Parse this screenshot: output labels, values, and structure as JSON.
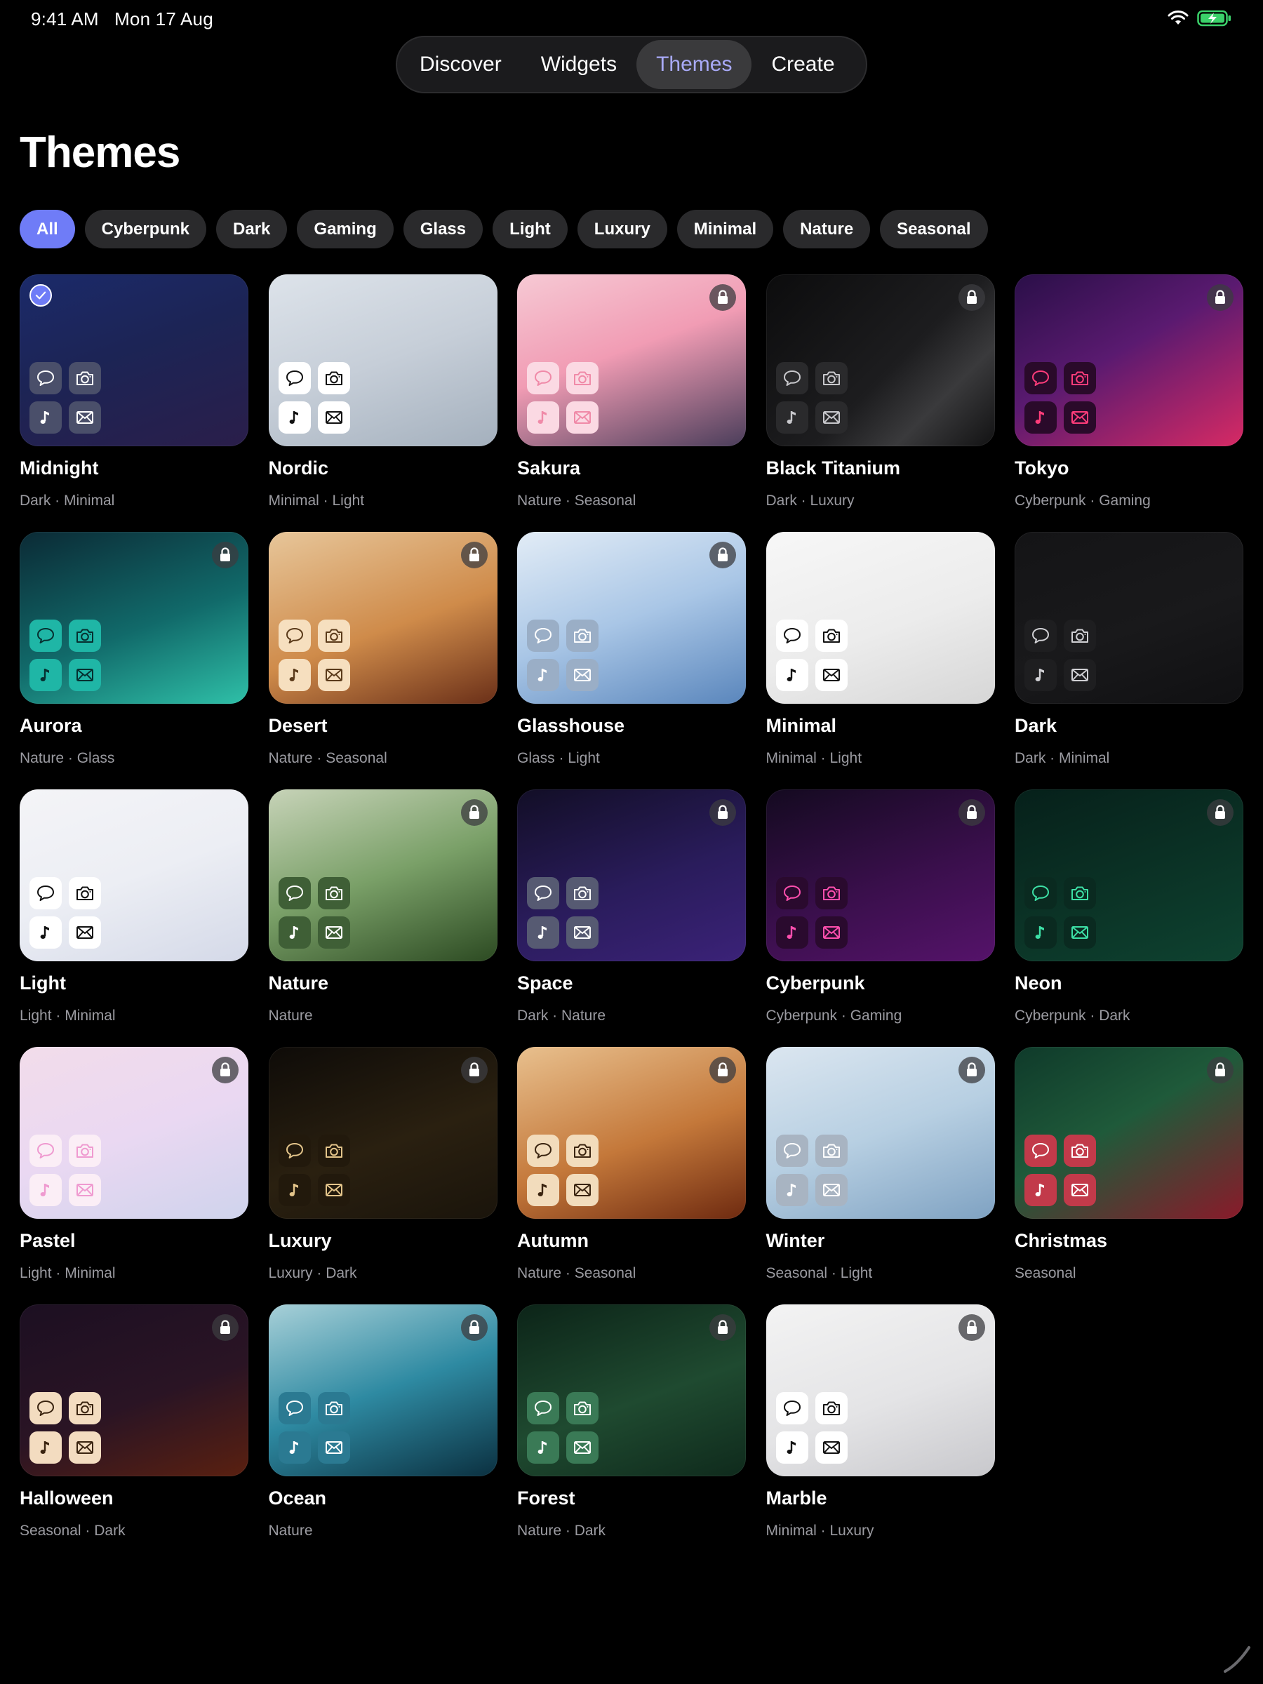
{
  "status": {
    "time": "9:41 AM",
    "date": "Mon 17 Aug"
  },
  "nav": {
    "tabs": [
      {
        "label": "Discover",
        "active": false
      },
      {
        "label": "Widgets",
        "active": false
      },
      {
        "label": "Themes",
        "active": true
      },
      {
        "label": "Create",
        "active": false
      }
    ]
  },
  "page": {
    "title": "Themes"
  },
  "filters": {
    "chips": [
      {
        "label": "All",
        "active": true
      },
      {
        "label": "Cyberpunk",
        "active": false
      },
      {
        "label": "Dark",
        "active": false
      },
      {
        "label": "Gaming",
        "active": false
      },
      {
        "label": "Glass",
        "active": false
      },
      {
        "label": "Light",
        "active": false
      },
      {
        "label": "Luxury",
        "active": false
      },
      {
        "label": "Minimal",
        "active": false
      },
      {
        "label": "Nature",
        "active": false
      },
      {
        "label": "Seasonal",
        "active": false
      }
    ]
  },
  "themes": [
    {
      "name": "Midnight",
      "tags": "Dark · Minimal",
      "selected": true,
      "locked": false,
      "bg": "linear-gradient(160deg,#1b2a6a 0%,#1c2455 45%,#2a1e4a 100%)",
      "icon_bg": "#4a4f6a",
      "icon_fg": "#ffffff"
    },
    {
      "name": "Nordic",
      "tags": "Minimal · Light",
      "selected": false,
      "locked": false,
      "bg": "linear-gradient(160deg,#dde3ea 0%,#c6ced8 50%,#a4b0bd 100%)",
      "icon_bg": "#ffffff",
      "icon_fg": "#111111"
    },
    {
      "name": "Sakura",
      "tags": "Nature · Seasonal",
      "selected": false,
      "locked": true,
      "bg": "linear-gradient(160deg,#f6c9d4 0%,#f19cb4 45%,#4a3d5a 100%)",
      "icon_bg": "#fbd9e3",
      "icon_fg": "#f08aa8"
    },
    {
      "name": "Black Titanium",
      "tags": "Dark · Luxury",
      "selected": false,
      "locked": true,
      "bg": "linear-gradient(135deg,#0c0c0d 0%,#1d1d1f 55%,#3a3a3c 75%,#121213 100%)",
      "icon_bg": "#2a2a2c",
      "icon_fg": "#c8c8cc"
    },
    {
      "name": "Tokyo",
      "tags": "Cyberpunk · Gaming",
      "selected": false,
      "locked": true,
      "bg": "linear-gradient(150deg,#2a0f48 0%,#5a1a70 45%,#d72a64 100%)",
      "icon_bg": "#2a0a2a",
      "icon_fg": "#ff3c7a"
    },
    {
      "name": "Aurora",
      "tags": "Nature · Glass",
      "selected": false,
      "locked": true,
      "bg": "linear-gradient(160deg,#0b2a35 0%,#116a6a 55%,#2fc0a8 100%)",
      "icon_bg": "#1fb6a6",
      "icon_fg": "#063030"
    },
    {
      "name": "Desert",
      "tags": "Nature · Seasonal",
      "selected": false,
      "locked": true,
      "bg": "linear-gradient(160deg,#e7c69a 0%,#cf8b4a 55%,#6a2f18 100%)",
      "icon_bg": "#f6dfbf",
      "icon_fg": "#5a3a1a"
    },
    {
      "name": "Glasshouse",
      "tags": "Glass · Light",
      "selected": false,
      "locked": true,
      "bg": "linear-gradient(160deg,#e2ecf6 0%,#a9c6e6 50%,#5a86bc 100%)",
      "icon_bg": "#9aaec6",
      "icon_fg": "#ffffff"
    },
    {
      "name": "Minimal",
      "tags": "Minimal · Light",
      "selected": false,
      "locked": false,
      "bg": "linear-gradient(160deg,#f7f7f7 0%,#ececec 55%,#d6d6d6 100%)",
      "icon_bg": "#ffffff",
      "icon_fg": "#111111"
    },
    {
      "name": "Dark",
      "tags": "Dark · Minimal",
      "selected": false,
      "locked": false,
      "bg": "linear-gradient(160deg,#141416 0%,#19191b 55%,#101012 100%)",
      "icon_bg": "#1e1e20",
      "icon_fg": "#d0d0d4"
    },
    {
      "name": "Light",
      "tags": "Light · Minimal",
      "selected": false,
      "locked": false,
      "bg": "linear-gradient(160deg,#f4f4f7 0%,#eceef4 50%,#d4d9e8 100%)",
      "icon_bg": "#ffffff",
      "icon_fg": "#111111"
    },
    {
      "name": "Nature",
      "tags": "Nature",
      "selected": false,
      "locked": true,
      "bg": "linear-gradient(160deg,#c7d3b8 0%,#7aa068 50%,#2c4a22 100%)",
      "icon_bg": "#3f5f36",
      "icon_fg": "#ffffff"
    },
    {
      "name": "Space",
      "tags": "Dark · Nature",
      "selected": false,
      "locked": true,
      "bg": "linear-gradient(160deg,#120e26 0%,#2a1c5c 55%,#3b2278 100%)",
      "icon_bg": "#565a72",
      "icon_fg": "#ffffff"
    },
    {
      "name": "Cyberpunk",
      "tags": "Cyberpunk · Gaming",
      "selected": false,
      "locked": true,
      "bg": "linear-gradient(160deg,#140a20 0%,#3a0f4c 55%,#55136a 100%)",
      "icon_bg": "#2a0a2e",
      "icon_fg": "#ff4fae"
    },
    {
      "name": "Neon",
      "tags": "Cyberpunk · Dark",
      "selected": false,
      "locked": true,
      "bg": "linear-gradient(160deg,#06201a 0%,#0b3326 55%,#0e4230 100%)",
      "icon_bg": "#0a2a20",
      "icon_fg": "#3de0a6"
    },
    {
      "name": "Pastel",
      "tags": "Light · Minimal",
      "selected": false,
      "locked": true,
      "bg": "linear-gradient(160deg,#f2dcea 0%,#ead8f2 50%,#cfd3ec 100%)",
      "icon_bg": "#fbeef6",
      "icon_fg": "#ef9ad0"
    },
    {
      "name": "Luxury",
      "tags": "Luxury · Dark",
      "selected": false,
      "locked": true,
      "bg": "linear-gradient(160deg,#0e0b08 0%,#2a2010 55%,#1a140b 100%)",
      "icon_bg": "#22190c",
      "icon_fg": "#e3c48a"
    },
    {
      "name": "Autumn",
      "tags": "Nature · Seasonal",
      "selected": false,
      "locked": true,
      "bg": "linear-gradient(160deg,#e8c08e 0%,#c4783a 55%,#6e2a10 100%)",
      "icon_bg": "#f2dcbc",
      "icon_fg": "#3a2410"
    },
    {
      "name": "Winter",
      "tags": "Seasonal · Light",
      "selected": false,
      "locked": true,
      "bg": "linear-gradient(160deg,#dbe6f0 0%,#b7cfe2 50%,#7fa2c2 100%)",
      "icon_bg": "#a8b4c2",
      "icon_fg": "#ffffff"
    },
    {
      "name": "Christmas",
      "tags": "Seasonal",
      "selected": false,
      "locked": true,
      "bg": "linear-gradient(150deg,#0f3a2a 0%,#1f5a3a 45%,#8a1a2a 100%)",
      "icon_bg": "#c23a4a",
      "icon_fg": "#ffffff"
    },
    {
      "name": "Halloween",
      "tags": "Seasonal · Dark",
      "selected": false,
      "locked": true,
      "bg": "linear-gradient(160deg,#1c0f22 0%,#2a1424 55%,#5a2010 100%)",
      "icon_bg": "#f3dcc0",
      "icon_fg": "#3a2410"
    },
    {
      "name": "Ocean",
      "tags": "Nature",
      "selected": false,
      "locked": true,
      "bg": "linear-gradient(160deg,#a8d0d8 0%,#2e8aa2 50%,#0b3040 100%)",
      "icon_bg": "#2b7a92",
      "icon_fg": "#ffffff"
    },
    {
      "name": "Forest",
      "tags": "Nature · Dark",
      "selected": false,
      "locked": true,
      "bg": "linear-gradient(160deg,#0c2418 0%,#1f4a30 55%,#0f2a1c 100%)",
      "icon_bg": "#3a7a56",
      "icon_fg": "#ffffff"
    },
    {
      "name": "Marble",
      "tags": "Minimal · Luxury",
      "selected": false,
      "locked": true,
      "bg": "linear-gradient(160deg,#f3f3f3 0%,#e4e4e6 55%,#c8c8cc 100%)",
      "icon_bg": "#ffffff",
      "icon_fg": "#111111"
    }
  ],
  "colors": {
    "accent": "#6f7cf7",
    "active_tab_text": "#a9aaf8",
    "tag_text": "#9b9ba1",
    "chip_bg": "#2a2a2c"
  }
}
